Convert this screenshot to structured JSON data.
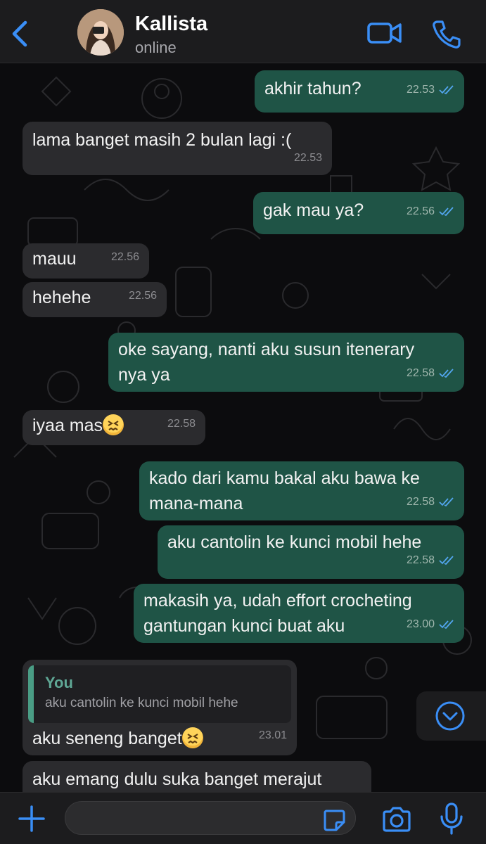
{
  "header": {
    "contact_name": "Kallista",
    "status": "online",
    "icons": [
      "chevron-left-icon",
      "avatar",
      "video-call-icon",
      "phone-icon"
    ]
  },
  "messages": [
    {
      "direction": "out",
      "text": "akhir tahun?",
      "time": "22.53",
      "read": true
    },
    {
      "direction": "in",
      "text": "lama banget masih 2 bulan lagi :(",
      "time": "22.53"
    },
    {
      "direction": "out",
      "text": "gak mau ya?",
      "time": "22.56",
      "read": true
    },
    {
      "direction": "in",
      "text": "mauu",
      "time": "22.56"
    },
    {
      "direction": "in",
      "text": "hehehe",
      "time": "22.56"
    },
    {
      "direction": "out",
      "text": "oke sayang, nanti aku susun itenerary nya ya",
      "time": "22.58",
      "read": true
    },
    {
      "direction": "in",
      "text": "iyaa mas",
      "emoji": "confounded-face",
      "time": "22.58"
    },
    {
      "direction": "out",
      "text": "kado dari kamu bakal aku bawa ke mana-mana",
      "time": "22.58",
      "read": true
    },
    {
      "direction": "out",
      "text": "aku cantolin ke kunci mobil hehe",
      "time": "22.58",
      "read": true
    },
    {
      "direction": "out",
      "text": "makasih ya, udah effort crocheting gantungan kunci buat aku",
      "time": "23.00",
      "read": true
    },
    {
      "direction": "in",
      "reply_to": {
        "author": "You",
        "text": "aku cantolin ke kunci mobil hehe"
      },
      "text": "aku seneng banget",
      "emoji": "confounded-face",
      "time": "23.01"
    },
    {
      "direction": "in",
      "text": "aku emang dulu suka banget merajut",
      "time": ""
    }
  ],
  "composer": {
    "value": "",
    "placeholder": "",
    "icons": [
      "plus-icon",
      "sticker-icon",
      "camera-icon",
      "microphone-icon"
    ]
  },
  "colors": {
    "background": "#0c0c0e",
    "header": "#1c1c1e",
    "outgoing_bubble": "#1f5446",
    "incoming_bubble": "#2b2b2e",
    "accent_blue": "#3a8ef6",
    "read_ticks": "#53a6f0",
    "reply_author": "#5fa795"
  }
}
